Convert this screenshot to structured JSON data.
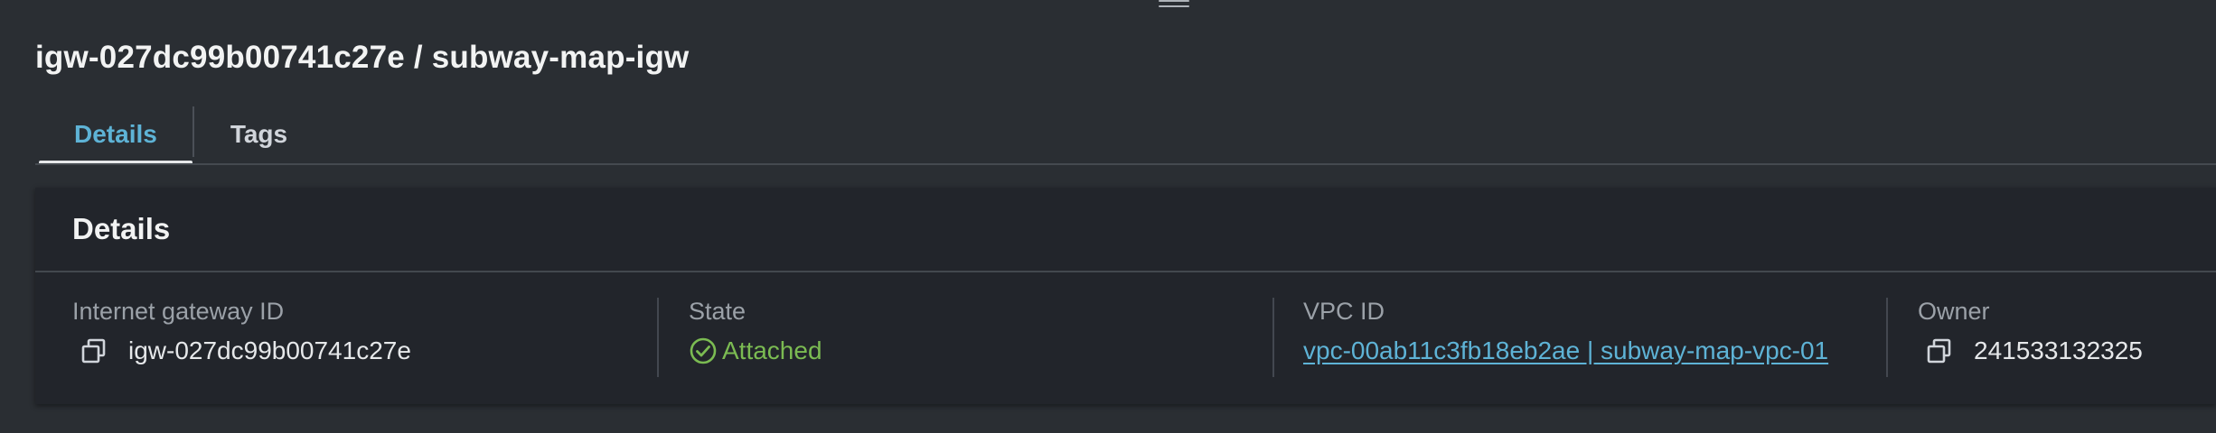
{
  "header": {
    "title": "igw-027dc99b00741c27e / subway-map-igw"
  },
  "tabs": [
    {
      "label": "Details",
      "active": true
    },
    {
      "label": "Tags",
      "active": false
    }
  ],
  "details_panel": {
    "title": "Details",
    "fields": {
      "internet_gateway_id": {
        "label": "Internet gateway ID",
        "value": "igw-027dc99b00741c27e",
        "icon": "copy-icon"
      },
      "state": {
        "label": "State",
        "value": "Attached",
        "icon": "check-circle-icon",
        "status_color": "#7bbb52"
      },
      "vpc_id": {
        "label": "VPC ID",
        "value": "vpc-00ab11c3fb18eb2ae | subway-map-vpc-01",
        "link_color": "#5eb3d6"
      },
      "owner": {
        "label": "Owner",
        "value": "241533132325",
        "icon": "copy-icon"
      }
    }
  },
  "colors": {
    "background": "#2a2e33",
    "panel": "#22252b",
    "accent": "#5eb3d6",
    "success": "#7bbb52"
  }
}
